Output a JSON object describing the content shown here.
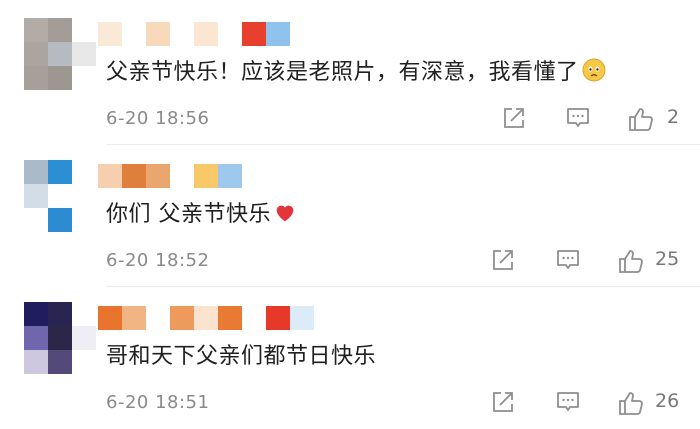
{
  "comments": [
    {
      "text": "父亲节快乐！应该是老照片，有深意，我看懂了",
      "emoji": "sad-face-emoji",
      "time": "6-20 18:56",
      "likes": "2"
    },
    {
      "text": "你们 父亲节快乐",
      "emoji": "red-heart-emoji",
      "time": "6-20 18:52",
      "likes": "25"
    },
    {
      "text": "哥和天下父亲们都节日快乐",
      "emoji": "",
      "time": "6-20 18:51",
      "likes": "26"
    }
  ],
  "icons": {
    "share": "share-icon",
    "reply": "comment-icon",
    "like": "thumbs-up-icon"
  },
  "colors": {
    "text": "#202020",
    "meta": "#8a8a8a",
    "icon": "#8f8f8f",
    "heart": "#e5353c",
    "emoji_face": "#f6c944"
  }
}
